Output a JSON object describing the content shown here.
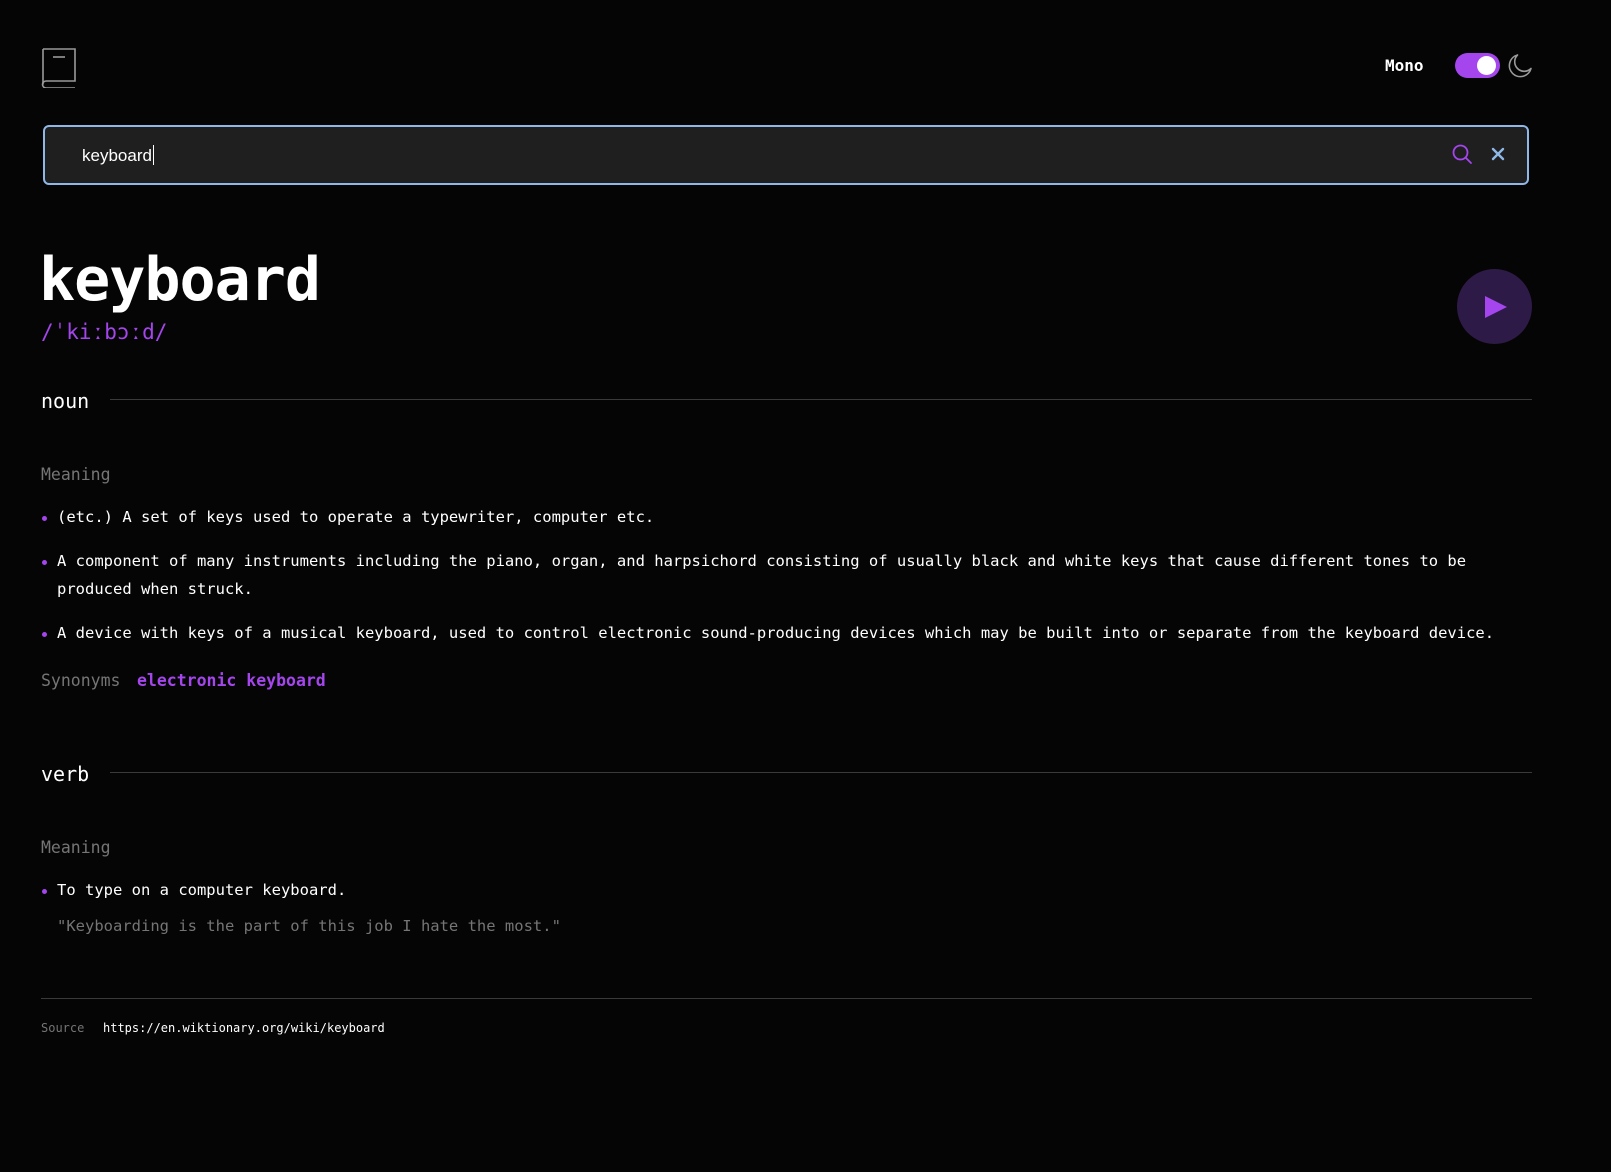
{
  "header": {
    "logo_icon": "book-icon",
    "font_label": "Mono",
    "theme_toggle_on": true,
    "theme_icon": "moon-icon",
    "accent_color": "#a445ed"
  },
  "search": {
    "value": "keyboard",
    "search_icon": "search-icon",
    "clear_icon": "close-icon"
  },
  "word": {
    "title": "keyboard",
    "phonetic": "/ˈkiːbɔːd/",
    "play_icon": "play-icon"
  },
  "meanings": [
    {
      "part_of_speech": "noun",
      "meaning_label": "Meaning",
      "definitions": [
        "(etc.) A set of keys used to operate a typewriter, computer etc.",
        "A component of many instruments including the piano, organ, and harpsichord consisting of usually black and white keys that cause different tones to be produced when struck.",
        "A device with keys of a musical keyboard, used to control electronic sound-producing devices which may be built into or separate from the keyboard device."
      ],
      "synonyms_label": "Synonyms",
      "synonyms": [
        "electronic keyboard"
      ]
    },
    {
      "part_of_speech": "verb",
      "meaning_label": "Meaning",
      "definitions": [
        "To type on a computer keyboard."
      ],
      "example": "\"Keyboarding is the part of this job I hate the most.\""
    }
  ],
  "footer": {
    "source_label": "Source",
    "source_url": "https://en.wiktionary.org/wiki/keyboard"
  }
}
